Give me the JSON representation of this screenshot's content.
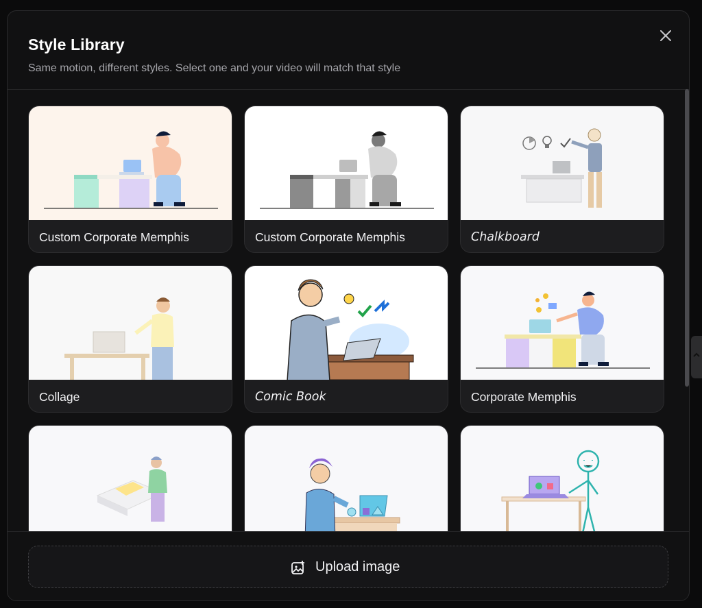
{
  "dialog": {
    "title": "Style Library",
    "subtitle": "Same motion, different styles. Select one and your video will match that style",
    "close_icon": "close-icon"
  },
  "styles": [
    {
      "label": "Custom Corporate Memphis",
      "thumbnail": "colored flat illustration of person leaning on pastel desk with laptop"
    },
    {
      "label": "Custom Corporate Memphis",
      "thumbnail": "grayscale flat illustration of person leaning on desk with laptop"
    },
    {
      "label": "Chalkboard",
      "thumbnail": "sketch of man pointing at icons beside desk"
    },
    {
      "label": "Collage",
      "thumbnail": "man standing beside wooden desk with laptop"
    },
    {
      "label": "Comic Book",
      "thumbnail": "comic style man pointing at icons and laptop"
    },
    {
      "label": "Corporate Memphis",
      "thumbnail": "flat illustration of person leaning on pastel desk with laptop and icons"
    },
    {
      "label": "",
      "thumbnail": "isometric person at desk"
    },
    {
      "label": "",
      "thumbnail": "cartoon boy pointing at laptop"
    },
    {
      "label": "",
      "thumbnail": "stick figure at desk with laptop"
    }
  ],
  "upload": {
    "label": "Upload image",
    "icon": "image-add-icon"
  },
  "colors": {
    "background": "#0b0b0c",
    "panel": "#111112",
    "card": "#1d1d1f",
    "text": "#f2f2f4",
    "muted": "#a5a5aa"
  }
}
